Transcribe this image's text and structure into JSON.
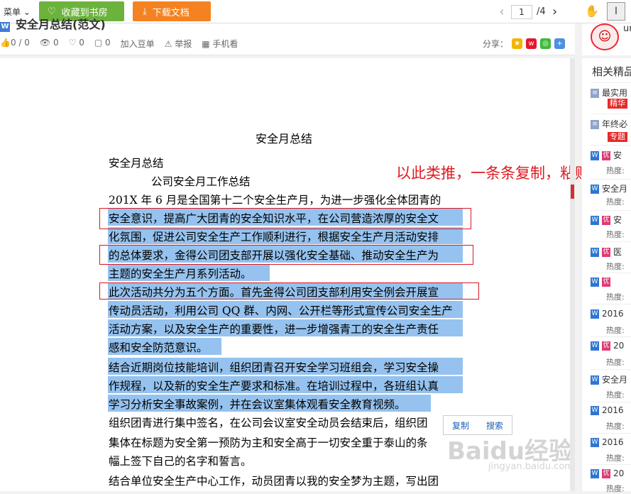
{
  "toolbar": {
    "menu_label": "菜单",
    "fav_label": "收藏到书房",
    "download_label": "下载文档",
    "page_current": "1",
    "page_total": "/4"
  },
  "docbar": {
    "title": "安全月总结(范文)",
    "likes": "0 / 0",
    "views": "0",
    "favs": "0",
    "comments": "0",
    "add_douban": "加入豆单",
    "report": "举报",
    "mobile": "手机看",
    "share_label": "分享："
  },
  "user": {
    "name": "ur"
  },
  "document": {
    "heading": "安全月总结",
    "lines": [
      "安全月总结",
      "公司安全月工作总结",
      "201X 年 6 月是全国第十二个安全生产月，为进一步强化全体团青的",
      "安全意识，提高广大团青的安全知识水平，在公司营造浓厚的安全文",
      "化氛围，促进公司安全生产工作顺利进行，根据安全生产月活动安排",
      "的总体要求，金得公司团支部开展以强化安全基础、推动安全生产为",
      "主题的安全生产月系列活动。",
      "此次活动共分为五个方面。首先金得公司团支部利用安全例会开展宣",
      "传动员活动，利用公司 QQ 群、内网、公开栏等形式宣传公司安全生产",
      "活动方案，以及安全生产的重要性，进一步增强青工的安全生产责任",
      "感和安全防范意识。",
      "结合近期岗位技能培训，组织团青召开安全学习班组会，学习安全操",
      "作规程，以及新的安全生产要求和标准。在培训过程中，各班组认真",
      "学习分析安全事故案例，并在会议室集体观看安全教育视频。",
      "组织团青进行集中签名，在公司会议室安全动员会结束后，组织团",
      "集体在标题为安全第一预防为主和安全高于一切安全重于泰山的条",
      "幅上签下自己的名字和誓言。",
      "结合单位安全生产中心工作，动员团青以我的安全梦为主题，写出团"
    ]
  },
  "annotation": "以此类推，一条条复制，粘贴",
  "popup": {
    "copy": "复制",
    "search": "搜索"
  },
  "watermark": {
    "text": "Baidu经验",
    "url": "jingyan.baidu.com"
  },
  "sidebar": {
    "title": "相关精品",
    "items": [
      {
        "label": "最实用",
        "badge": "精华",
        "hot": ""
      },
      {
        "label": "年终必",
        "badge": "专题",
        "hot": ""
      },
      {
        "label": "安",
        "badge": "",
        "hot": "热度:"
      },
      {
        "label": "安全月",
        "badge": "",
        "hot": "热度:"
      },
      {
        "label": "安",
        "badge": "",
        "hot": "热度:"
      },
      {
        "label": "医",
        "badge": "",
        "hot": "热度:"
      },
      {
        "label": "",
        "badge": "",
        "hot": "热度:"
      },
      {
        "label": "2016",
        "badge": "",
        "hot": "热度:"
      },
      {
        "label": "20",
        "badge": "",
        "hot": "热度:"
      },
      {
        "label": "安全月",
        "badge": "",
        "hot": "热度:"
      },
      {
        "label": "2016",
        "badge": "",
        "hot": "热度:"
      },
      {
        "label": "2016",
        "badge": "",
        "hot": "热度:"
      },
      {
        "label": "20",
        "badge": "",
        "hot": "热度:"
      }
    ]
  },
  "colors": {
    "green": "#6cb33e",
    "orange": "#f58220",
    "highlight": "#3e8fe0",
    "red": "#d9191f"
  }
}
